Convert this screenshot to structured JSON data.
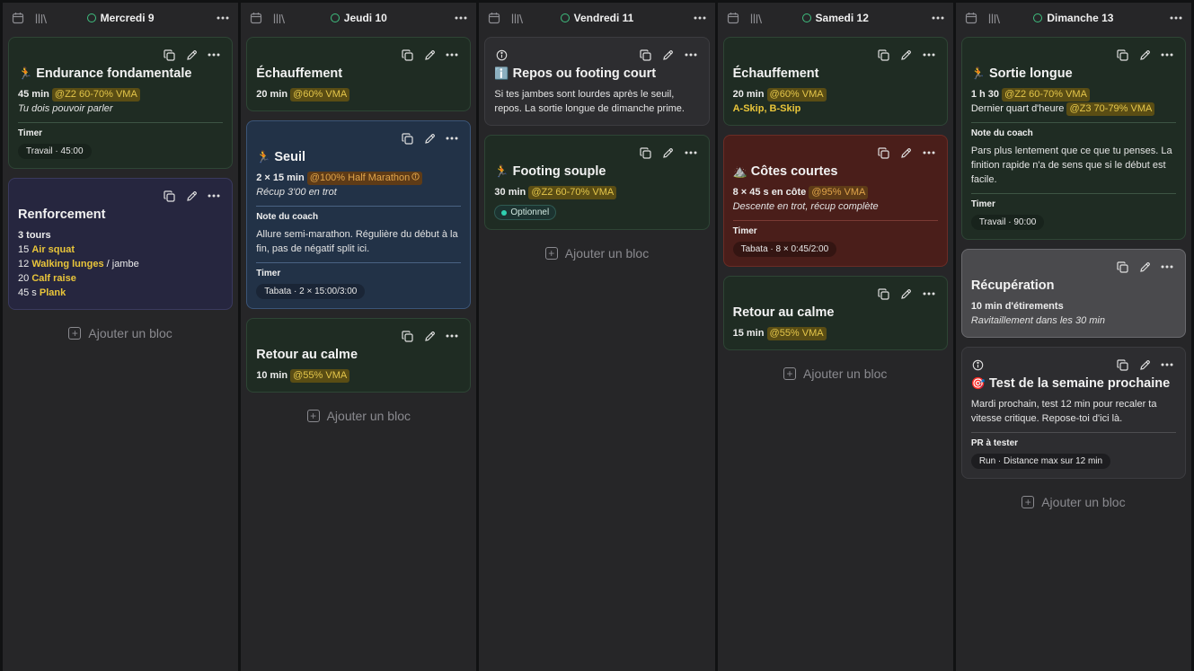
{
  "columns": [
    {
      "day": "Mercredi 9",
      "add_label": "Ajouter un bloc",
      "cards": [
        {
          "color": "green",
          "emoji": "🏃",
          "title": "Endurance fondamentale",
          "rows": [
            {
              "type": "metric",
              "bold": "45 min",
              "pill": "@Z2 60-70% VMA"
            },
            {
              "type": "italic",
              "text": "Tu dois pouvoir parler"
            },
            {
              "type": "sep"
            },
            {
              "type": "label",
              "text": "Timer"
            },
            {
              "type": "chip",
              "text": "Travail · 45:00"
            }
          ]
        },
        {
          "color": "purple",
          "title": "Renforcement",
          "rows": [
            {
              "type": "bold",
              "text": "3 tours"
            },
            {
              "type": "exercise",
              "count": "15",
              "name": "Air squat",
              "suffix": ""
            },
            {
              "type": "exercise",
              "count": "12",
              "name": "Walking lunges",
              "suffix": " / jambe"
            },
            {
              "type": "exercise",
              "count": "20",
              "name": "Calf raise",
              "suffix": ""
            },
            {
              "type": "exercise",
              "count": "45 s",
              "name": "Plank",
              "suffix": ""
            }
          ]
        }
      ]
    },
    {
      "day": "Jeudi 10",
      "add_label": "Ajouter un bloc",
      "cards": [
        {
          "color": "green",
          "title": "Échauffement",
          "rows": [
            {
              "type": "metric",
              "bold": "20 min",
              "pill": "@60% VMA"
            }
          ]
        },
        {
          "color": "blue",
          "emoji": "🏃",
          "title": "Seuil",
          "rows": [
            {
              "type": "metric",
              "bold": "2 × 15 min",
              "pill": "@100% Half Marathon",
              "pill_style": "orange",
              "pill_icon": true
            },
            {
              "type": "italic",
              "text": "Récup 3'00 en trot"
            },
            {
              "type": "sep"
            },
            {
              "type": "label",
              "text": "Note du coach"
            },
            {
              "type": "para",
              "text": "Allure semi-marathon. Régulière du début à la fin, pas de négatif split ici."
            },
            {
              "type": "sep"
            },
            {
              "type": "label",
              "text": "Timer"
            },
            {
              "type": "chip",
              "text": "Tabata · 2 × 15:00/3:00"
            }
          ]
        },
        {
          "color": "green",
          "title": "Retour au calme",
          "rows": [
            {
              "type": "metric",
              "bold": "10 min",
              "pill": "@55% VMA"
            }
          ]
        }
      ]
    },
    {
      "day": "Vendredi 11",
      "add_label": "Ajouter un bloc",
      "cards": [
        {
          "color": "grey",
          "info": true,
          "emoji": "ℹ️",
          "title": "Repos ou footing court",
          "rows": [
            {
              "type": "para",
              "text": "Si tes jambes sont lourdes après le seuil, repos. La sortie longue de dimanche prime."
            }
          ]
        },
        {
          "color": "green",
          "emoji": "🏃",
          "title": "Footing souple",
          "rows": [
            {
              "type": "metric",
              "bold": "30 min",
              "pill": "@Z2 60-70% VMA"
            },
            {
              "type": "optional",
              "text": "Optionnel"
            }
          ]
        }
      ]
    },
    {
      "day": "Samedi 12",
      "add_label": "Ajouter un bloc",
      "cards": [
        {
          "color": "green",
          "title": "Échauffement",
          "rows": [
            {
              "type": "metric",
              "bold": "20 min",
              "pill": "@60% VMA"
            },
            {
              "type": "yellowtext",
              "text": "A-Skip, B-Skip"
            }
          ]
        },
        {
          "color": "red",
          "emoji": "⛰️",
          "title": "Côtes courtes",
          "rows": [
            {
              "type": "metric",
              "bold": "8 × 45 s en côte",
              "pill": "@95% VMA",
              "pill_style": "orange"
            },
            {
              "type": "italic",
              "text": "Descente en trot, récup complète"
            },
            {
              "type": "sep"
            },
            {
              "type": "label",
              "text": "Timer"
            },
            {
              "type": "chip",
              "text": "Tabata · 8 × 0:45/2:00"
            }
          ]
        },
        {
          "color": "green",
          "title": "Retour au calme",
          "rows": [
            {
              "type": "metric",
              "bold": "15 min",
              "pill": "@55% VMA"
            }
          ]
        }
      ]
    },
    {
      "day": "Dimanche 13",
      "add_label": "Ajouter un bloc",
      "cards": [
        {
          "color": "green",
          "emoji": "🏃",
          "title": "Sortie longue",
          "rows": [
            {
              "type": "metric",
              "bold": "1 h 30",
              "pill": "@Z2 60-70% VMA"
            },
            {
              "type": "metric2",
              "text": "Dernier quart d'heure",
              "pill": "@Z3 70-79% VMA"
            },
            {
              "type": "sep"
            },
            {
              "type": "label",
              "text": "Note du coach"
            },
            {
              "type": "para",
              "text": "Pars plus lentement que ce que tu penses. La finition rapide n'a de sens que si le début est facile."
            },
            {
              "type": "sep"
            },
            {
              "type": "label",
              "text": "Timer"
            },
            {
              "type": "chip",
              "text": "Travail · 90:00"
            }
          ]
        },
        {
          "color": "lightgrey",
          "title": "Récupération",
          "rows": [
            {
              "type": "bold",
              "text": "10 min d'étirements"
            },
            {
              "type": "italic",
              "text": "Ravitaillement dans les 30 min"
            }
          ]
        },
        {
          "color": "grey",
          "info": true,
          "emoji": "🎯",
          "title": "Test de la semaine prochaine",
          "rows": [
            {
              "type": "para",
              "text": "Mardi prochain, test 12 min pour recaler ta vitesse critique. Repose-toi d'ici là."
            },
            {
              "type": "sep"
            },
            {
              "type": "label",
              "text": "PR à tester"
            },
            {
              "type": "chip",
              "text": "Run · Distance max sur 12 min"
            }
          ]
        }
      ]
    }
  ]
}
